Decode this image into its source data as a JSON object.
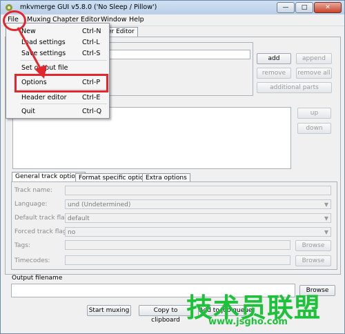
{
  "window": {
    "title": "mkvmerge GUI v5.8.0 ('No Sleep / Pillow')",
    "minimize": "—",
    "maximize": "□",
    "close": "✕"
  },
  "menubar": {
    "file": "File",
    "muxing": "Muxing",
    "chapter_editor": "Chapter Editor",
    "window": "Window",
    "help": "Help"
  },
  "file_menu": {
    "items": [
      {
        "label": "New",
        "shortcut": "Ctrl-N"
      },
      {
        "label": "Load settings",
        "shortcut": "Ctrl-L"
      },
      {
        "label": "Save settings",
        "shortcut": "Ctrl-S"
      },
      {
        "label": "Set output file",
        "shortcut": ""
      },
      {
        "label": "Options",
        "shortcut": "Ctrl-P"
      },
      {
        "label": "Header editor",
        "shortcut": "Ctrl-E"
      },
      {
        "label": "Quit",
        "shortcut": "Ctrl-Q"
      }
    ]
  },
  "top_tab_partial": "er Editor",
  "input_buttons": {
    "add": "add",
    "append": "append",
    "remove": "remove",
    "remove_all": "remove all",
    "additional_parts": "additional parts"
  },
  "track_buttons": {
    "up": "up",
    "down": "down"
  },
  "track_tabs": {
    "general": "General track options",
    "format": "Format specific options",
    "extra": "Extra options"
  },
  "track_options": {
    "track_name_label": "Track name:",
    "language_label": "Language:",
    "language_value": "und (Undetermined)",
    "default_flag_label": "Default track flag:",
    "default_flag_value": "default",
    "forced_flag_label": "Forced track flag:",
    "forced_flag_value": "no",
    "tags_label": "Tags:",
    "timecodes_label": "Timecodes:",
    "browse": "Browse"
  },
  "output": {
    "label": "Output filename",
    "browse": "Browse"
  },
  "bottom_buttons": {
    "start_muxing": "Start muxing",
    "copy_clipboard": "Copy to clipboard",
    "add_job": "Add to job queue"
  },
  "watermark": {
    "text": "技术员联盟",
    "url": "www.jsgho.com"
  },
  "colors": {
    "annotation_red": "#e3262e",
    "watermark_green": "#1ec23a"
  }
}
